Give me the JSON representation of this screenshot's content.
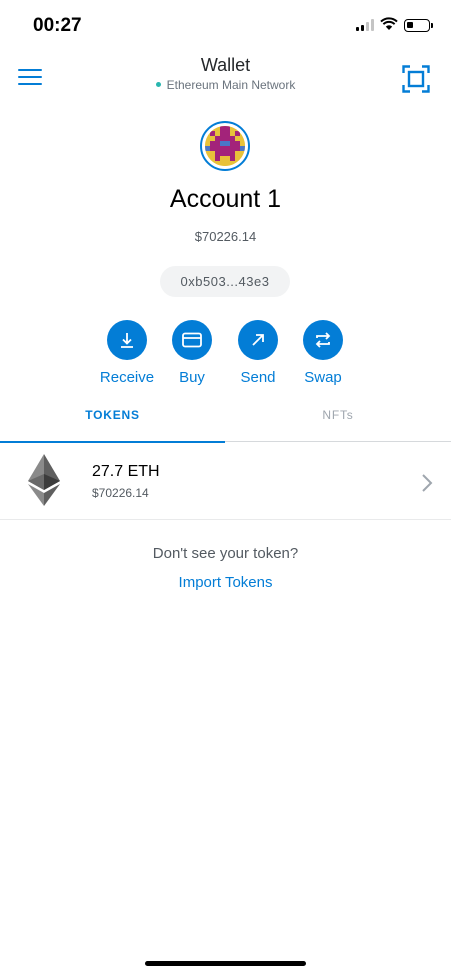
{
  "status_bar": {
    "time": "00:27",
    "signal_bars_filled": 2,
    "signal_bars_total": 4,
    "battery_level": 0.3
  },
  "header": {
    "title": "Wallet",
    "network": "Ethereum Main Network",
    "network_status_color": "#29b6af",
    "menu_icon": "hamburger-menu-icon",
    "scan_icon": "qr-scan-icon"
  },
  "account": {
    "name": "Account 1",
    "balance": "$70226.14",
    "address": "0xb503...43e3"
  },
  "actions": [
    {
      "label": "Receive",
      "icon": "receive-arrow-icon"
    },
    {
      "label": "Buy",
      "icon": "card-icon"
    },
    {
      "label": "Send",
      "icon": "send-arrow-icon"
    },
    {
      "label": "Swap",
      "icon": "swap-arrows-icon"
    }
  ],
  "tabs": {
    "tokens": "TOKENS",
    "nfts": "NFTs",
    "active": "tokens"
  },
  "tokens": [
    {
      "amount": "27.7 ETH",
      "fiat": "$70226.14",
      "icon": "ethereum-logo-icon"
    }
  ],
  "import": {
    "prompt": "Don't see your token?",
    "link": "Import Tokens"
  },
  "colors": {
    "accent": "#037dd6",
    "text": "#24272a",
    "muted": "#535a61"
  }
}
